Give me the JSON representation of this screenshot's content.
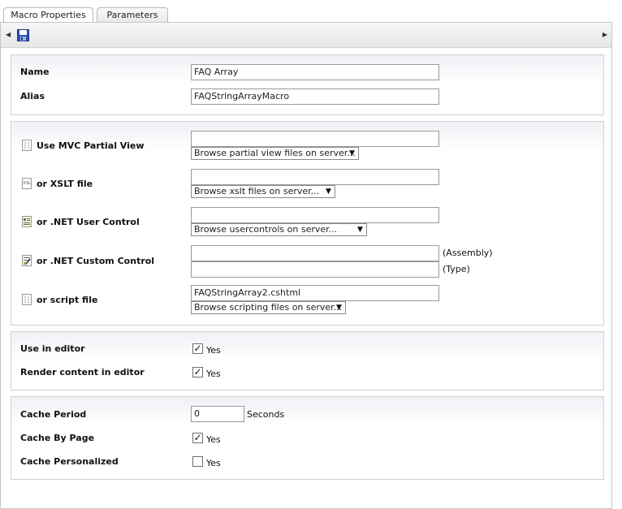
{
  "tabs": [
    {
      "label": "Macro Properties",
      "active": true
    },
    {
      "label": "Parameters",
      "active": false
    }
  ],
  "toolbar": {
    "save_icon": "save-icon"
  },
  "properties": {
    "name_label": "Name",
    "name_value": "FAQ Array",
    "alias_label": "Alias",
    "alias_value": "FAQStringArrayMacro"
  },
  "sources": {
    "mvc": {
      "label": "Use MVC Partial View",
      "value": "",
      "dropdown": "Browse partial view files on server..."
    },
    "xslt": {
      "label": "or XSLT file",
      "value": "",
      "dropdown": "Browse xslt files on server...",
      "icon_text": "XSL"
    },
    "usercontrol": {
      "label": "or .NET User Control",
      "value": "",
      "dropdown": "Browse usercontrols on server..."
    },
    "customcontrol": {
      "label": "or .NET Custom Control",
      "assembly_value": "",
      "type_value": "",
      "assembly_label": "(Assembly)",
      "type_label": "(Type)"
    },
    "script": {
      "label": "or script file",
      "value": "FAQStringArray2.cshtml",
      "dropdown": "Browse scripting files on server..."
    }
  },
  "editor": {
    "use_label": "Use in editor",
    "use_checked": true,
    "render_label": "Render content in editor",
    "render_checked": true,
    "yes": "Yes"
  },
  "cache": {
    "period_label": "Cache Period",
    "period_value": "0",
    "seconds": "Seconds",
    "by_page_label": "Cache By Page",
    "by_page_checked": true,
    "personalized_label": "Cache Personalized",
    "personalized_checked": false,
    "yes": "Yes"
  },
  "check_mark": "✓"
}
